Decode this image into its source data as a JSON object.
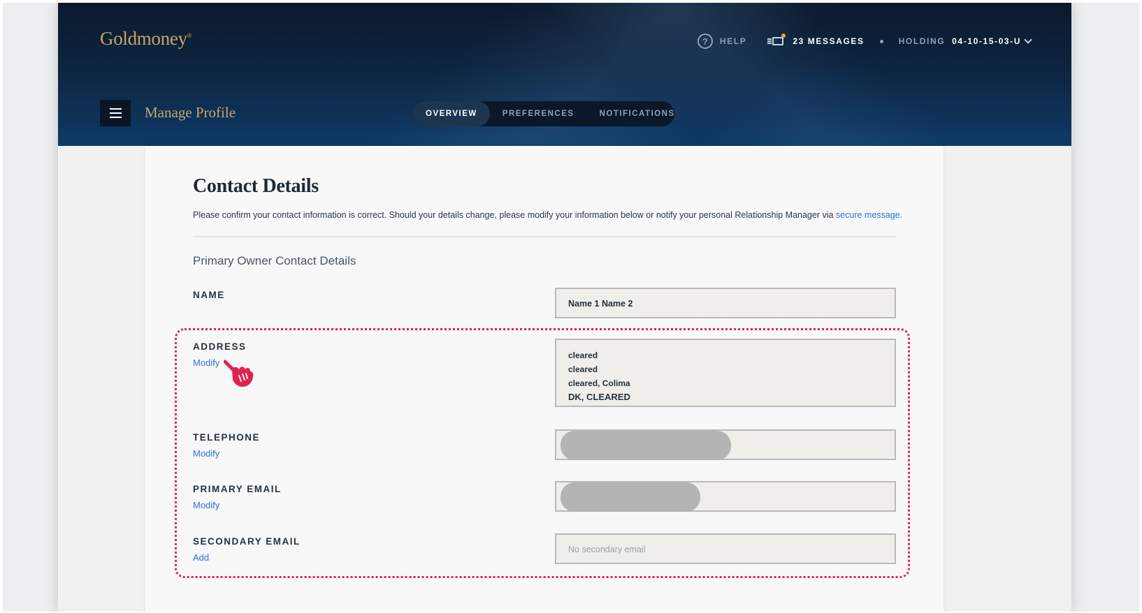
{
  "header": {
    "brand": "Goldmoney",
    "brand_mark": "®",
    "help_label": "HELP",
    "messages_label": "23 MESSAGES",
    "holding_label": "HOLDING",
    "holding_value": "04-10-15-03-U",
    "page_title": "Manage Profile",
    "tabs": [
      {
        "label": "OVERVIEW",
        "active": true
      },
      {
        "label": "PREFERENCES",
        "active": false
      },
      {
        "label": "NOTIFICATIONS",
        "active": false
      }
    ]
  },
  "card": {
    "title": "Contact Details",
    "intro_text": "Please confirm your contact information is correct. Should your details change, please modify your information below or notify your personal Relationship Manager via ",
    "intro_link": "secure message.",
    "section_title": "Primary Owner Contact Details",
    "fields": {
      "name": {
        "label": "NAME",
        "value": "Name 1 Name 2"
      },
      "address": {
        "label": "ADDRESS",
        "action": "Modify",
        "lines": [
          "cleared",
          "cleared",
          "cleared, Colima",
          "DK, CLEARED"
        ]
      },
      "telephone": {
        "label": "TELEPHONE",
        "action": "Modify"
      },
      "primary_email": {
        "label": "PRIMARY EMAIL",
        "action": "Modify"
      },
      "secondary_email": {
        "label": "SECONDARY EMAIL",
        "action": "Add",
        "placeholder": "No secondary email"
      }
    }
  },
  "colors": {
    "brand_gold": "#c8a56a",
    "header_navy": "#0d2440",
    "link_blue": "#2f6fd1",
    "highlight_red": "#e0234e"
  },
  "icons": [
    "help-icon",
    "messages-icon",
    "chevron-down-icon",
    "menu-icon",
    "pointing-hand-icon"
  ]
}
